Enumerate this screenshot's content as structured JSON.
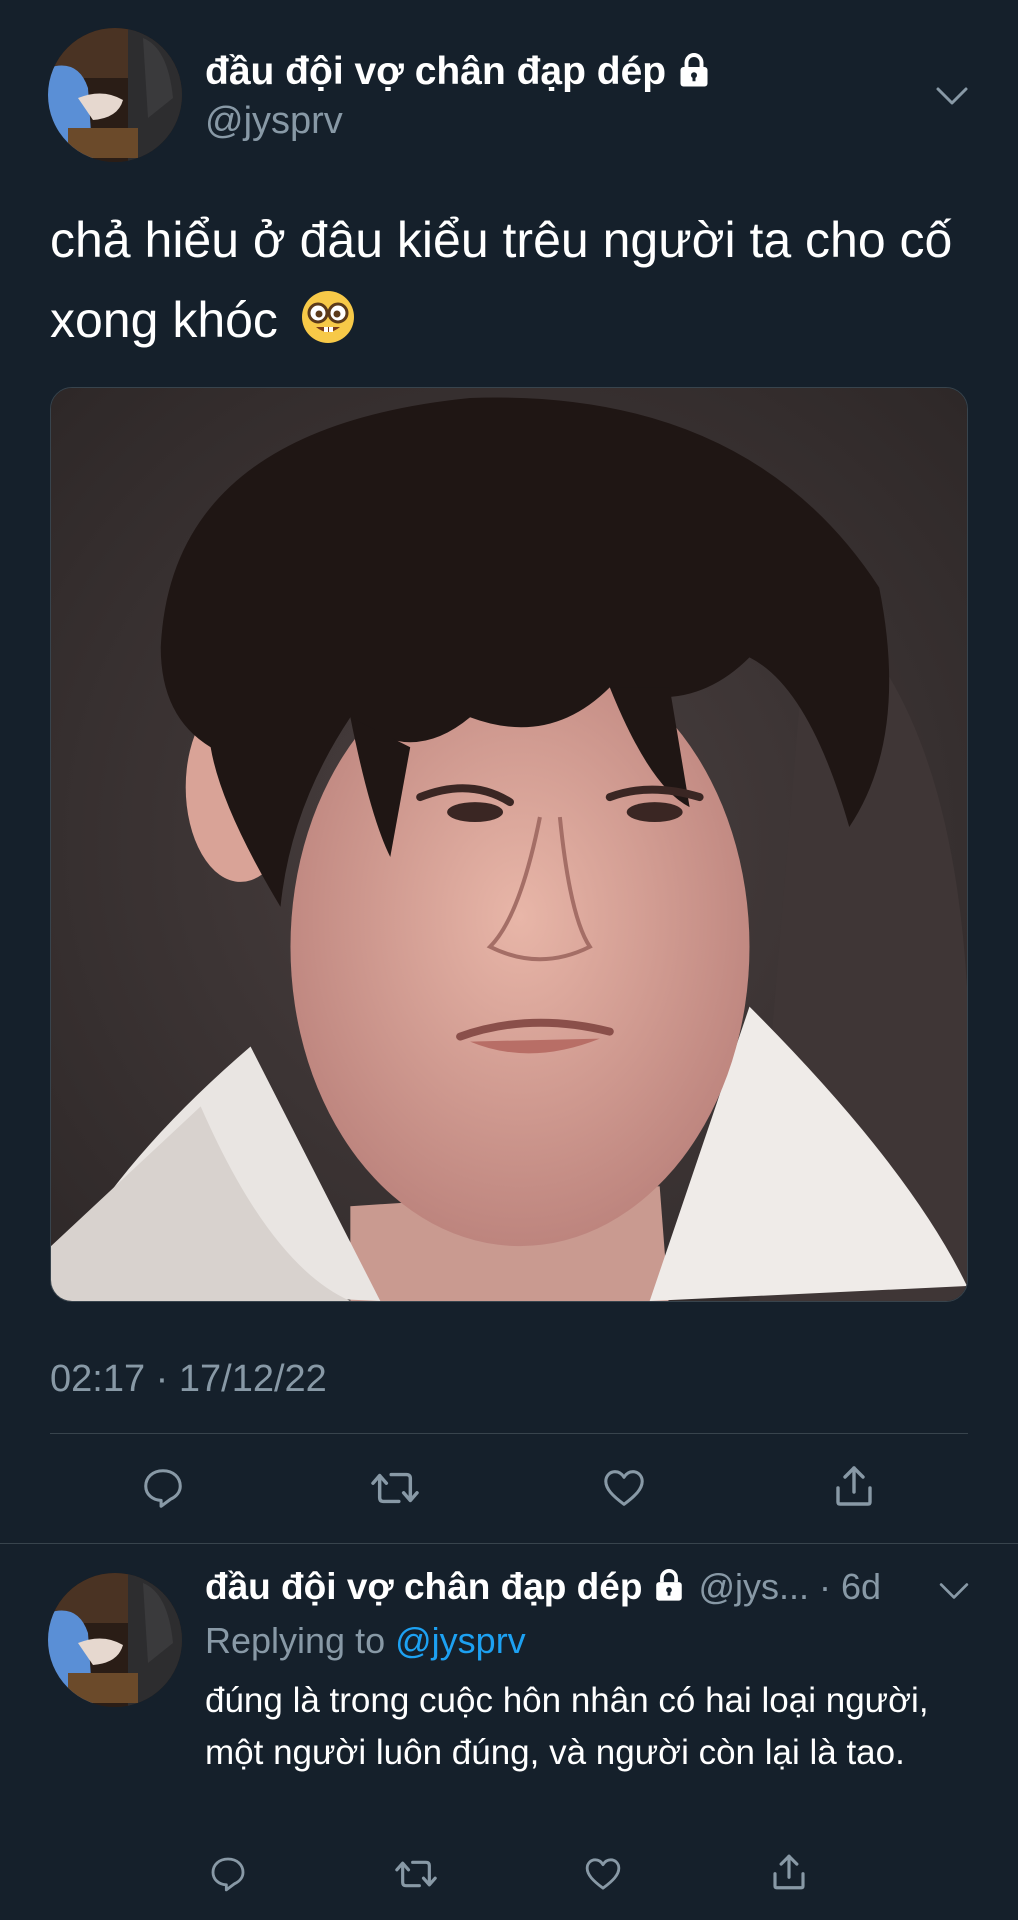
{
  "theme": {
    "background": "#15202b",
    "text_primary": "#ffffff",
    "text_secondary": "#8899a6",
    "accent": "#1da1f2",
    "divider": "#38444d"
  },
  "main_tweet": {
    "author": {
      "display_name": "đầu đội vợ chân đạp dép",
      "handle": "@jysprv",
      "protected": true,
      "avatar_icon": "avatar-photo"
    },
    "text": "chả hiểu ở đâu kiểu trêu người ta cho cố xong khóc",
    "emoji": "nerd-face-emoji",
    "media": {
      "type": "photo",
      "icon": "photo"
    },
    "timestamp": "02:17 · 17/12/22",
    "actions": [
      "reply-icon",
      "retweet-icon",
      "like-icon",
      "share-icon"
    ]
  },
  "reply": {
    "author": {
      "display_name": "đầu đội vợ chân đạp dép",
      "handle": "@jys...",
      "protected": true,
      "avatar_icon": "avatar-photo"
    },
    "time_ago": "· 6d",
    "replying_to_label": "Replying to",
    "replying_to_handle": "@jysprv",
    "text": "đúng là trong cuộc hôn nhân có hai loại người, một người luôn đúng, và người còn lại là tao.",
    "actions": [
      "reply-icon",
      "retweet-icon",
      "like-icon",
      "share-icon"
    ]
  }
}
